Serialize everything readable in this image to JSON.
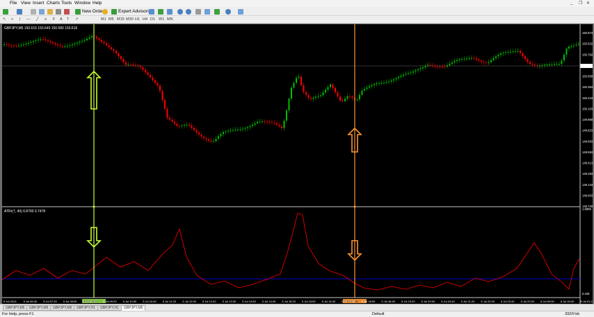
{
  "menu": [
    "File",
    "View",
    "Insert",
    "Charts",
    "Tools",
    "Window",
    "Help"
  ],
  "toolbar": {
    "new_order": "New Order",
    "expert_advisors": "Expert Advisors",
    "timeframes": [
      "M1",
      "M5",
      "M15",
      "M30",
      "H1",
      "H4",
      "D1",
      "W1",
      "MN"
    ]
  },
  "chart": {
    "header": "GBPJPY,M5  150.615 150.649 150.580 150.616",
    "indicator_header": "ATRr(7, 49) 0.8700 0.7478",
    "price_labels": [
      "150.873",
      "150.532",
      "150.760",
      "150.616",
      "150.658",
      "150.383",
      "150.243",
      "150.103",
      "149.968",
      "149.823",
      "149.693",
      "149.553",
      "149.413",
      "149.283",
      "149.143",
      "149.003",
      "148.720"
    ],
    "indicator_labels": [
      "1.8999",
      "0.349"
    ],
    "time_labels": [
      "5 Jul 2013",
      "5 Jul 06:40",
      "5 Jul 07:20",
      "5 Jul 08:00",
      "5 Jul 08:40",
      "5 Jul 09:20",
      "5 Jul 10:00",
      "5 Jul 10:40",
      "5 Jul 11:20",
      "5 Jul 12:00",
      "5 Jul 12:40",
      "5 Jul 13:20",
      "5 Jul 14:00",
      "5 Jul 14:40",
      "5 Jul 15:20",
      "5 Jul 16:00",
      "5 Jul 16:40",
      "5 Jul 17:20",
      "5 Jul 18:00",
      "5 Jul 18:40",
      "5 Jul 19:20",
      "5 Jul 20:00",
      "5 Jul 20:40",
      "5 Jul 21:20",
      "5 Jul 22:00",
      "5 Jul 22:40",
      "5 Jul 23:20",
      "8 Jul 00:00",
      "8 Jul 00:40",
      "8 Jul 01:20"
    ],
    "crosshair_left_label": "5 Jul 08:50",
    "crosshair_right_label": "5 Jul 17:10",
    "colors": {
      "background": "#000000",
      "bull": "#00c000",
      "bear": "#ff0000",
      "indicator": "#ff0000",
      "left_marker": "#c8ff32",
      "right_marker": "#ff9632",
      "level_line": "#0000c8"
    }
  },
  "tabs": [
    "GBPJPY,M5",
    "GBPJPY,M5",
    "GBPJPY,M5",
    "GBPJPY,H1",
    "GBPJPY,H1",
    "GBPJPY,M5"
  ],
  "status": {
    "help": "For Help, press F1",
    "profile": "Default",
    "traffic": "332/0 kb"
  }
}
